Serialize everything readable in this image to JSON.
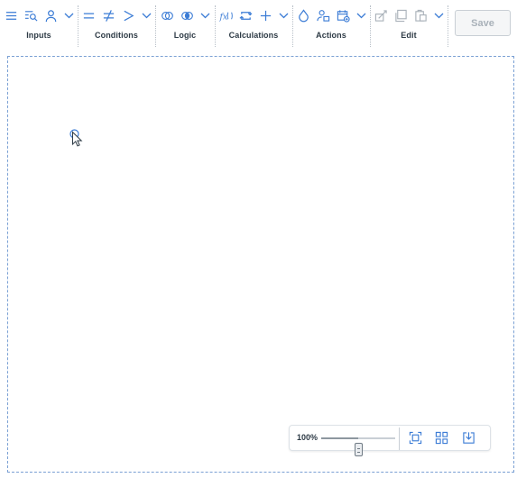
{
  "toolbar": {
    "groups": [
      {
        "label": "Inputs",
        "icons": [
          "list-icon",
          "filter-search-icon",
          "user-icon"
        ]
      },
      {
        "label": "Conditions",
        "icons": [
          "equals-icon",
          "not-equals-icon",
          "greater-than-icon"
        ]
      },
      {
        "label": "Logic",
        "icons": [
          "union-icon",
          "intersection-icon"
        ]
      },
      {
        "label": "Calculations",
        "icons": [
          "function-icon",
          "loop-icon",
          "plus-icon"
        ]
      },
      {
        "label": "Actions",
        "icons": [
          "drop-icon",
          "user-assign-icon",
          "calendar-action-icon"
        ]
      },
      {
        "label": "Edit",
        "icons": [
          "cut-icon",
          "copy-icon",
          "paste-icon"
        ]
      }
    ],
    "save_label": "Save"
  },
  "zoom": {
    "value_label": "100%",
    "level": 0.5,
    "icons": [
      "fit-to-screen-icon",
      "grid-icon",
      "download-icon"
    ]
  },
  "colors": {
    "accent": "#3a7bd5",
    "icon": "#3a7bd5",
    "disabled_icon": "#a9b1b9",
    "text": "#2d3a45",
    "canvas_border": "#7aa0d4"
  }
}
